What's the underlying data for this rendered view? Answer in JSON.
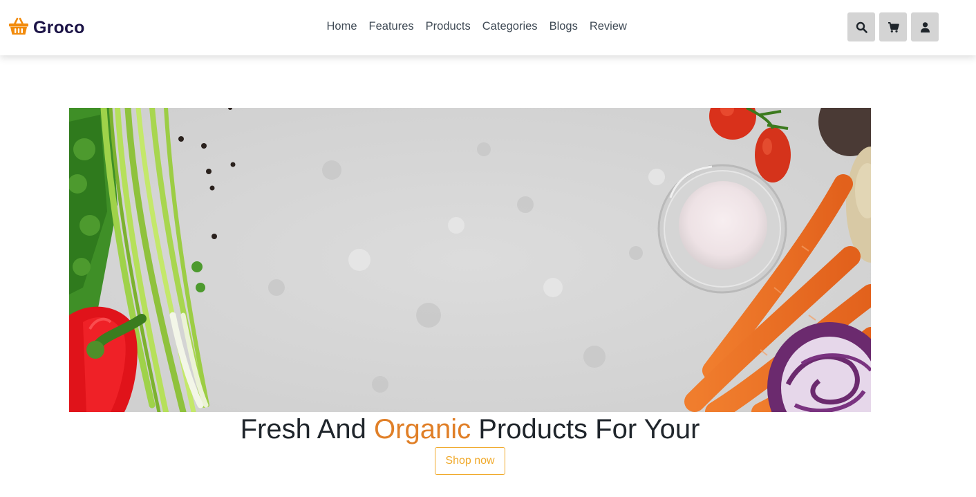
{
  "brand": {
    "name": "Groco",
    "logo_icon": "basket-icon",
    "accent_color": "#f28b0c",
    "text_color": "#1b1346"
  },
  "nav": {
    "items": [
      {
        "label": "Home"
      },
      {
        "label": "Features"
      },
      {
        "label": "Products"
      },
      {
        "label": "Categories"
      },
      {
        "label": "Blogs"
      },
      {
        "label": "Review"
      }
    ]
  },
  "header_icons": [
    {
      "icon": "search-icon"
    },
    {
      "icon": "cart-icon"
    },
    {
      "icon": "user-icon"
    }
  ],
  "hero": {
    "image": "vegetables-on-stone-background",
    "headline_before": "Fresh And ",
    "headline_accent": "Organic",
    "headline_after": " Products For Your",
    "accent_color": "#e07f27",
    "cta_label": "Shop now",
    "cta_color": "#f0a92a"
  }
}
